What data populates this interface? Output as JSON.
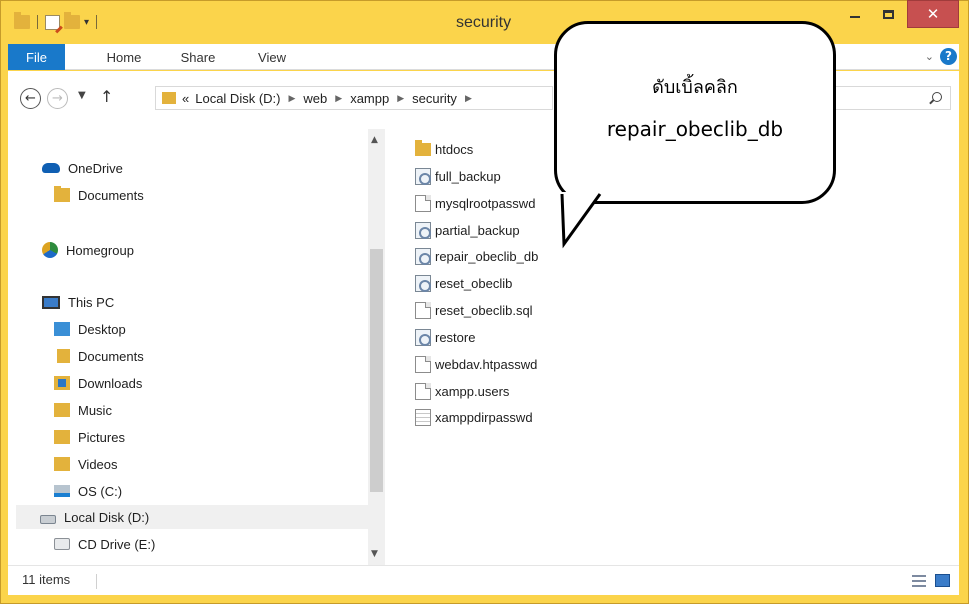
{
  "window": {
    "title": "security"
  },
  "ribbon": {
    "tabs": [
      {
        "label": "File"
      },
      {
        "label": "Home"
      },
      {
        "label": "Share"
      },
      {
        "label": "View"
      }
    ]
  },
  "address": {
    "overflow": "«",
    "crumbs": [
      "Local Disk (D:)",
      "web",
      "xampp",
      "security"
    ]
  },
  "nav": {
    "items": [
      {
        "label": "OneDrive",
        "icon": "onedrive-icon"
      },
      {
        "label": "Documents",
        "icon": "folder-icon"
      },
      {
        "label": "Homegroup",
        "icon": "homegroup-icon"
      },
      {
        "label": "This PC",
        "icon": "computer-icon"
      },
      {
        "label": "Desktop",
        "icon": "desktop-folder-icon"
      },
      {
        "label": "Documents",
        "icon": "documents-folder-icon"
      },
      {
        "label": "Downloads",
        "icon": "downloads-folder-icon"
      },
      {
        "label": "Music",
        "icon": "music-folder-icon"
      },
      {
        "label": "Pictures",
        "icon": "pictures-folder-icon"
      },
      {
        "label": "Videos",
        "icon": "videos-folder-icon"
      },
      {
        "label": "OS (C:)",
        "icon": "os-drive-icon"
      },
      {
        "label": "Local Disk (D:)",
        "icon": "local-disk-icon",
        "selected": true
      },
      {
        "label": "CD Drive (E:)",
        "icon": "cd-drive-icon"
      }
    ]
  },
  "files": [
    {
      "name": "htdocs",
      "icon": "folder-icon"
    },
    {
      "name": "full_backup",
      "icon": "batch-file-icon"
    },
    {
      "name": "mysqlrootpasswd",
      "icon": "file-icon"
    },
    {
      "name": "partial_backup",
      "icon": "batch-file-icon"
    },
    {
      "name": "repair_obeclib_db",
      "icon": "batch-file-icon"
    },
    {
      "name": "reset_obeclib",
      "icon": "batch-file-icon"
    },
    {
      "name": "reset_obeclib.sql",
      "icon": "file-icon"
    },
    {
      "name": "restore",
      "icon": "batch-file-icon"
    },
    {
      "name": "webdav.htpasswd",
      "icon": "file-icon"
    },
    {
      "name": "xampp.users",
      "icon": "file-icon"
    },
    {
      "name": "xamppdirpasswd",
      "icon": "text-file-icon"
    }
  ],
  "callout": {
    "line1": "ดับเบิ้ลคลิก",
    "line2": "repair_obeclib_db"
  },
  "status": {
    "count": "11 items"
  },
  "colors": {
    "frame": "#fbd44b",
    "file_tab": "#1979ca",
    "close_button": "#c75050",
    "folder": "#e3b23c"
  }
}
